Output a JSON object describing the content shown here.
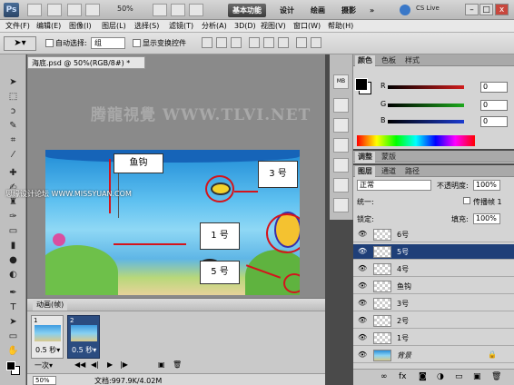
{
  "titlebar": {
    "logo": "Ps",
    "zoom": "50%",
    "workspaces": [
      "基本功能",
      "设计",
      "绘画",
      "摄影"
    ],
    "more": "»",
    "cslive": "CS Live",
    "win_min": "–",
    "win_max": "□",
    "win_close": "x"
  },
  "menubar": {
    "items": [
      "文件(F)",
      "编辑(E)",
      "图像(I)",
      "图层(L)",
      "选择(S)",
      "滤镜(T)",
      "分析(A)",
      "3D(D)",
      "视图(V)",
      "窗口(W)",
      "帮助(H)"
    ]
  },
  "options": {
    "auto_select_label": "自动选择:",
    "auto_select_value": "组",
    "show_transform_label": "显示变换控件"
  },
  "document": {
    "tab_title": "海底.psd @ 50%(RGB/8#) *",
    "watermark": "腾龍視覺 WWW.TLVI.NET",
    "forum_text": "思缘设计论坛 WWW.MISSYUAN.COM",
    "callouts": [
      "鱼钩",
      "3 号",
      "1 号",
      "5 号"
    ]
  },
  "animation": {
    "title": "动画(帧)",
    "frames": [
      {
        "num": "1",
        "time": "0.5 秒▾"
      },
      {
        "num": "2",
        "time": "0.5 秒▾"
      }
    ],
    "loop": "一次▾",
    "zoom": "50%",
    "doc_info": "文档:997.9K/4.02M"
  },
  "minidock": [
    "MB",
    "",
    "",
    "",
    "",
    "",
    "",
    ""
  ],
  "color_panel": {
    "tabs": [
      "颜色",
      "色板",
      "样式"
    ],
    "channels": [
      {
        "label": "R",
        "value": "0",
        "color": "#d01c1c"
      },
      {
        "label": "G",
        "value": "0",
        "color": "#1ca81c"
      },
      {
        "label": "B",
        "value": "0",
        "color": "#1c3cd0"
      }
    ]
  },
  "adjust_panel": {
    "tabs": [
      "调整",
      "蒙版"
    ]
  },
  "layers_panel": {
    "tabs": [
      "图层",
      "通道",
      "路径"
    ],
    "blend_mode": "正常",
    "opacity_label": "不透明度:",
    "opacity": "100%",
    "unify_label": "统一:",
    "propagate_label": "传播帧 1",
    "lock_label": "锁定:",
    "fill_label": "填充:",
    "fill": "100%",
    "layers": [
      {
        "name": "6号",
        "selected": false
      },
      {
        "name": "5号",
        "selected": true
      },
      {
        "name": "4号",
        "selected": false
      },
      {
        "name": "鱼钩",
        "selected": false
      },
      {
        "name": "3号",
        "selected": false
      },
      {
        "name": "2号",
        "selected": false
      },
      {
        "name": "1号",
        "selected": false
      },
      {
        "name": "背景",
        "selected": false
      }
    ]
  }
}
